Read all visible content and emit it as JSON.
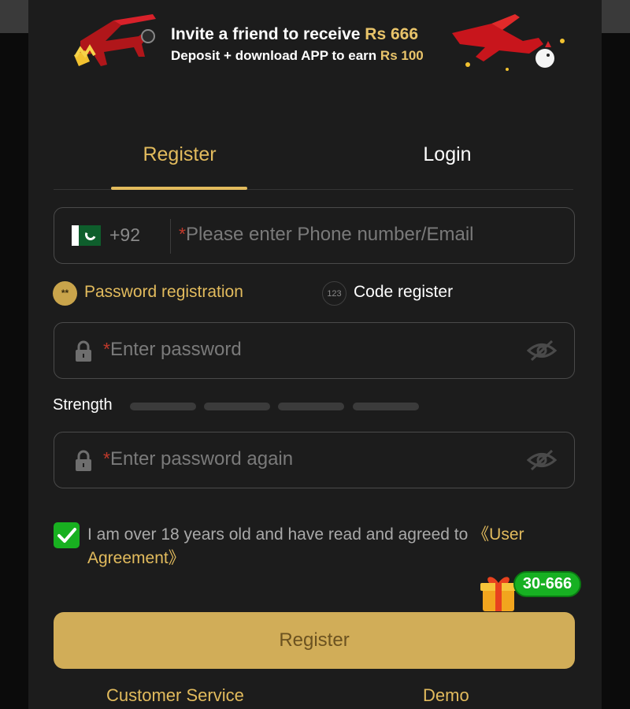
{
  "banner": {
    "line1_text": "Invite a friend to receive",
    "line1_amount": "Rs 666",
    "line2_text": "Deposit + download APP to earn",
    "line2_amount": "Rs 100"
  },
  "tabs": [
    {
      "label": "Register",
      "active": true
    },
    {
      "label": "Login",
      "active": false
    }
  ],
  "phone": {
    "country_code": "+92",
    "required_mark": "*",
    "placeholder": "Please enter Phone number/Email",
    "flag": "pakistan-flag-icon"
  },
  "registration_modes": [
    {
      "label": "Password registration",
      "icon_text": "**",
      "active": true
    },
    {
      "label": "Code register",
      "icon_text": "123",
      "active": false
    }
  ],
  "password": {
    "required_mark": "*",
    "placeholder": "Enter password",
    "icon": "lock-icon",
    "toggle_icon": "eye-hidden-icon"
  },
  "strength": {
    "label": "Strength",
    "levels": 4,
    "filled": 0
  },
  "password_again": {
    "required_mark": "*",
    "placeholder": "Enter password again"
  },
  "agreement": {
    "checked": true,
    "text": "I am over 18 years old and have read and agreed to ",
    "link": "《User Agreement》"
  },
  "gift": {
    "badge": "30-666",
    "icon": "gift-box-icon"
  },
  "register_button": "Register",
  "footer": {
    "customer_service": "Customer Service",
    "demo": "Demo"
  },
  "colors": {
    "accent": "#e2bb5d",
    "button": "#d1ad58",
    "panel": "#1c1c1c",
    "check": "#18b020"
  }
}
